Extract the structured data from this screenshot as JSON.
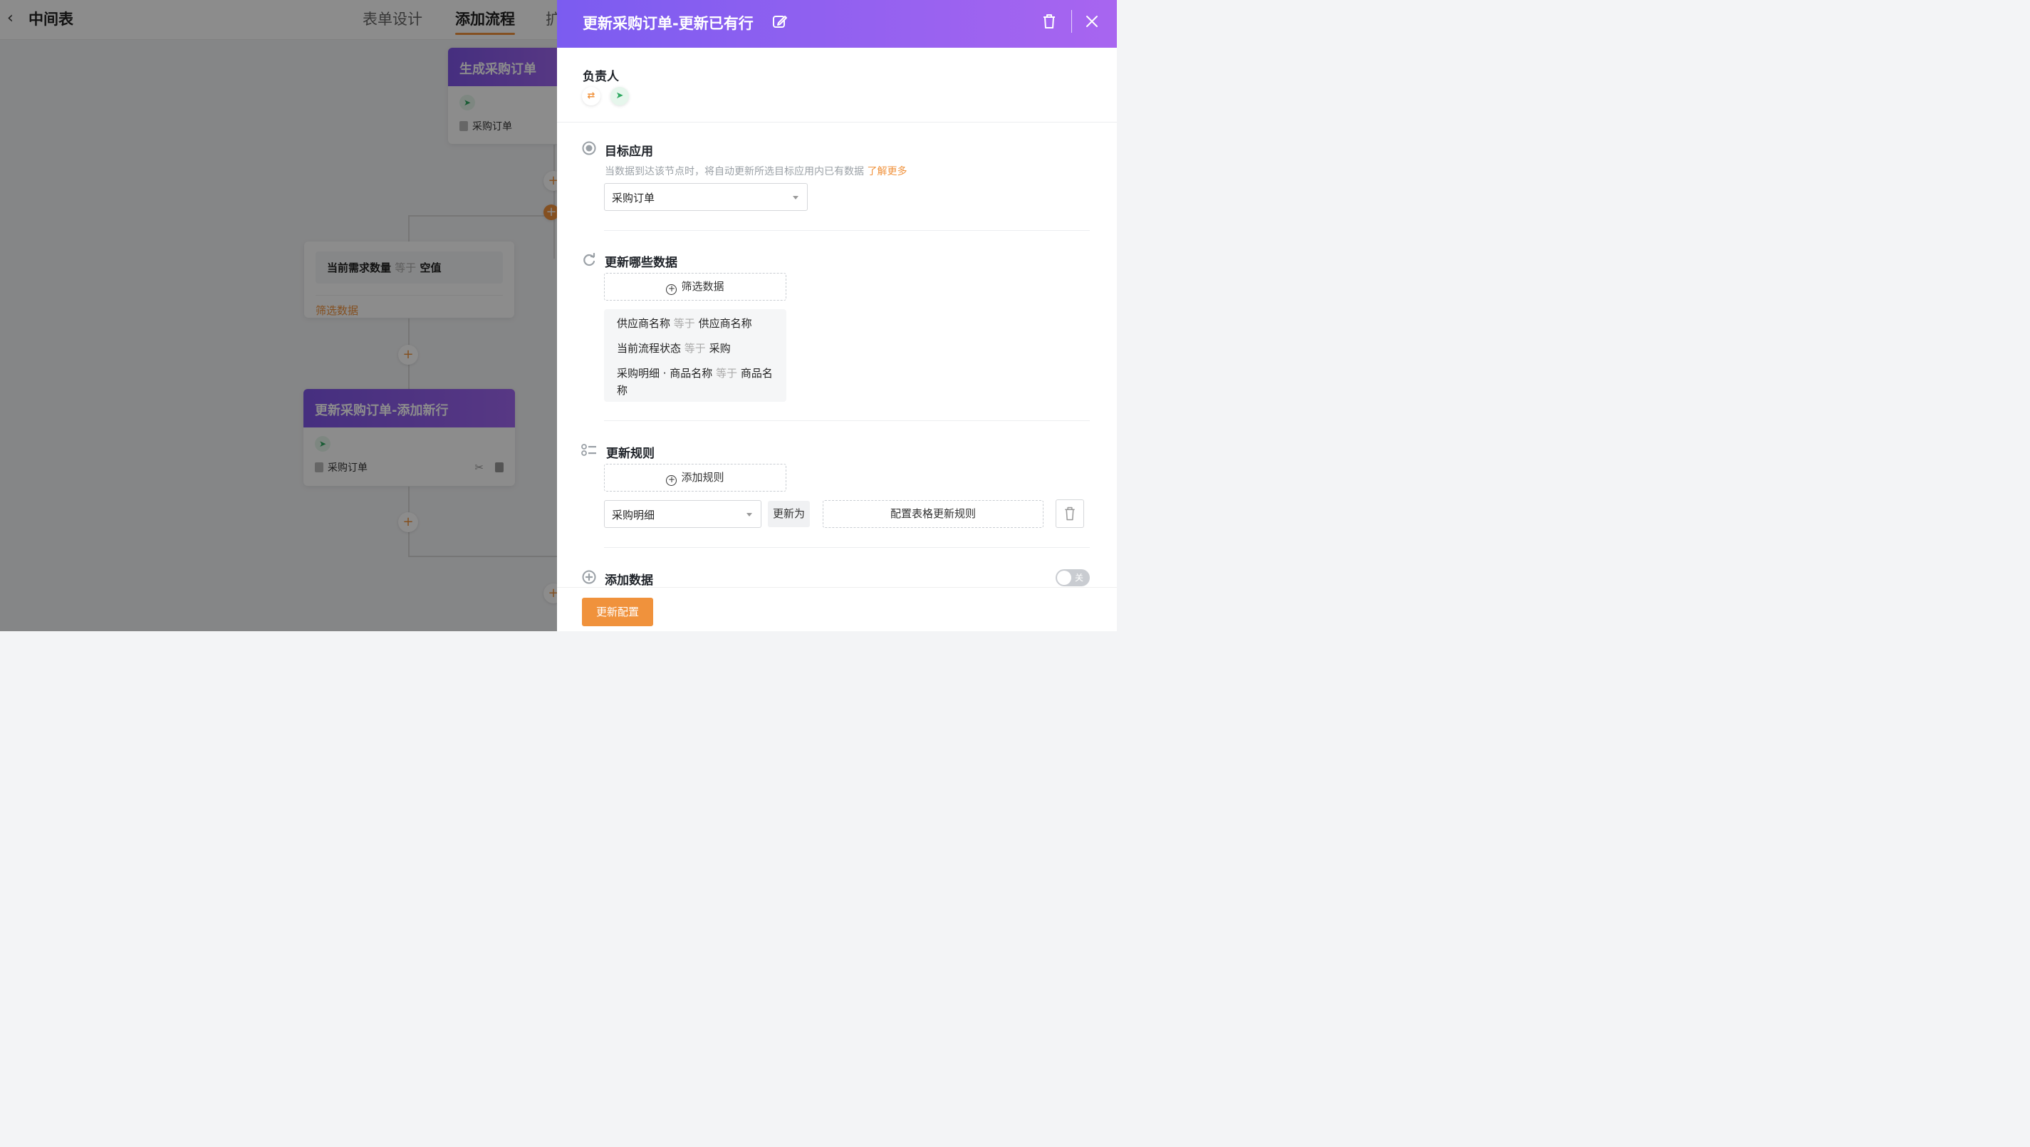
{
  "header": {
    "back_glyph": "‹",
    "app_title": "中间表",
    "tabs": [
      {
        "label": "表单设计",
        "active": false
      },
      {
        "label": "添加流程",
        "active": true
      },
      {
        "label": "扩",
        "active": false
      }
    ]
  },
  "flow": {
    "card_generate": {
      "title": "生成采购订单",
      "doc": "采购订单"
    },
    "condition_card": {
      "field": "当前需求数量",
      "op": "等于",
      "value": "空值",
      "link": "筛选数据"
    },
    "card_add_row": {
      "title": "更新采购订单-添加新行",
      "doc": "采购订单"
    }
  },
  "drawer": {
    "title": "更新采购订单-更新已有行",
    "owner": {
      "label": "负责人"
    },
    "target_app": {
      "label": "目标应用",
      "hint": "当数据到达该节点时，将自动更新所选目标应用内已有数据",
      "hint_link": "了解更多",
      "selected": "采购订单"
    },
    "which_data": {
      "label": "更新哪些数据",
      "filter_button": "筛选数据",
      "conditions": [
        {
          "field": "供应商名称",
          "op": "等于",
          "value": "供应商名称"
        },
        {
          "field": "当前流程状态",
          "op": "等于",
          "value": "采购"
        },
        {
          "field": "采购明细 · 商品名称",
          "op": "等于",
          "value": "商品名称"
        }
      ]
    },
    "rules": {
      "label": "更新规则",
      "add_button": "添加规则",
      "field_select": "采购明细",
      "update_to": "更新为",
      "config_button": "配置表格更新规则"
    },
    "add_data": {
      "label": "添加数据",
      "toggle_text": "关",
      "enabled": false
    },
    "submit": "更新配置"
  },
  "colors": {
    "accent": "#f0923c",
    "header_gradient_start": "#7b5cf0",
    "header_gradient_end": "#a865f0"
  }
}
